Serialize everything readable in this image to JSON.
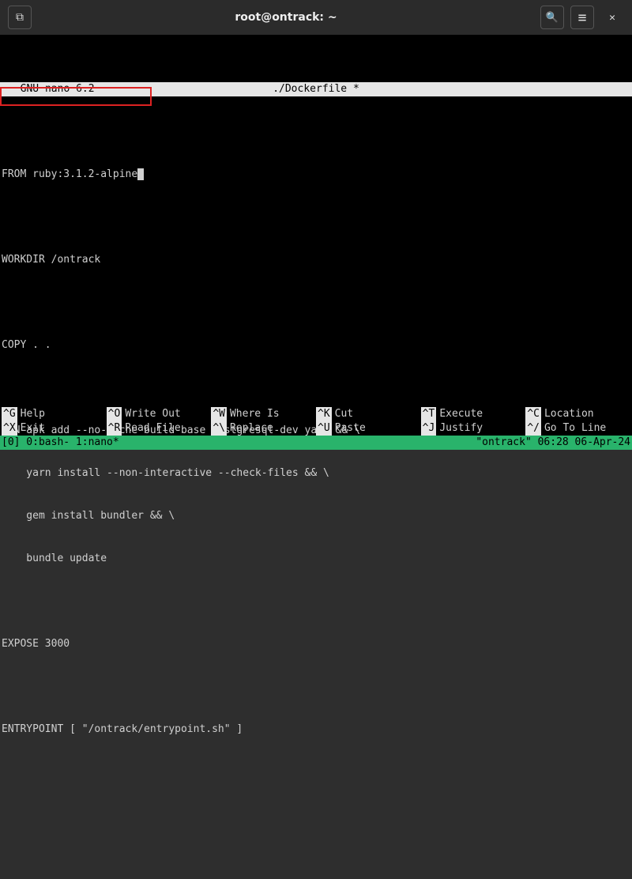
{
  "titlebar": {
    "title": "root@ontrack: ~"
  },
  "nano": {
    "version_label": "  GNU nano 6.2",
    "filename": "./Dockerfile *"
  },
  "editor": {
    "lines": [
      "FROM ruby:3.1.2-alpine",
      "",
      "WORKDIR /ontrack",
      "",
      "COPY . .",
      "",
      "RUN apk add --no-cache build-base postgresql-dev yarn && \\",
      "    yarn install --non-interactive --check-files && \\",
      "    gem install bundler && \\",
      "    bundle update",
      "",
      "EXPOSE 3000",
      "",
      "ENTRYPOINT [ \"/ontrack/entrypoint.sh\" ]"
    ]
  },
  "shortcuts": {
    "row1": [
      {
        "key": "^G",
        "label": "Help"
      },
      {
        "key": "^O",
        "label": "Write Out"
      },
      {
        "key": "^W",
        "label": "Where Is"
      },
      {
        "key": "^K",
        "label": "Cut"
      },
      {
        "key": "^T",
        "label": "Execute"
      },
      {
        "key": "^C",
        "label": "Location"
      }
    ],
    "row2": [
      {
        "key": "^X",
        "label": "Exit"
      },
      {
        "key": "^R",
        "label": "Read File"
      },
      {
        "key": "^\\",
        "label": "Replace"
      },
      {
        "key": "^U",
        "label": "Paste"
      },
      {
        "key": "^J",
        "label": "Justify"
      },
      {
        "key": "^/",
        "label": "Go To Line"
      }
    ]
  },
  "tmux": {
    "tabs": "[0] 0:bash- 1:nano*",
    "status_right": "\"ontrack\" 06:28 06-Apr-24"
  }
}
